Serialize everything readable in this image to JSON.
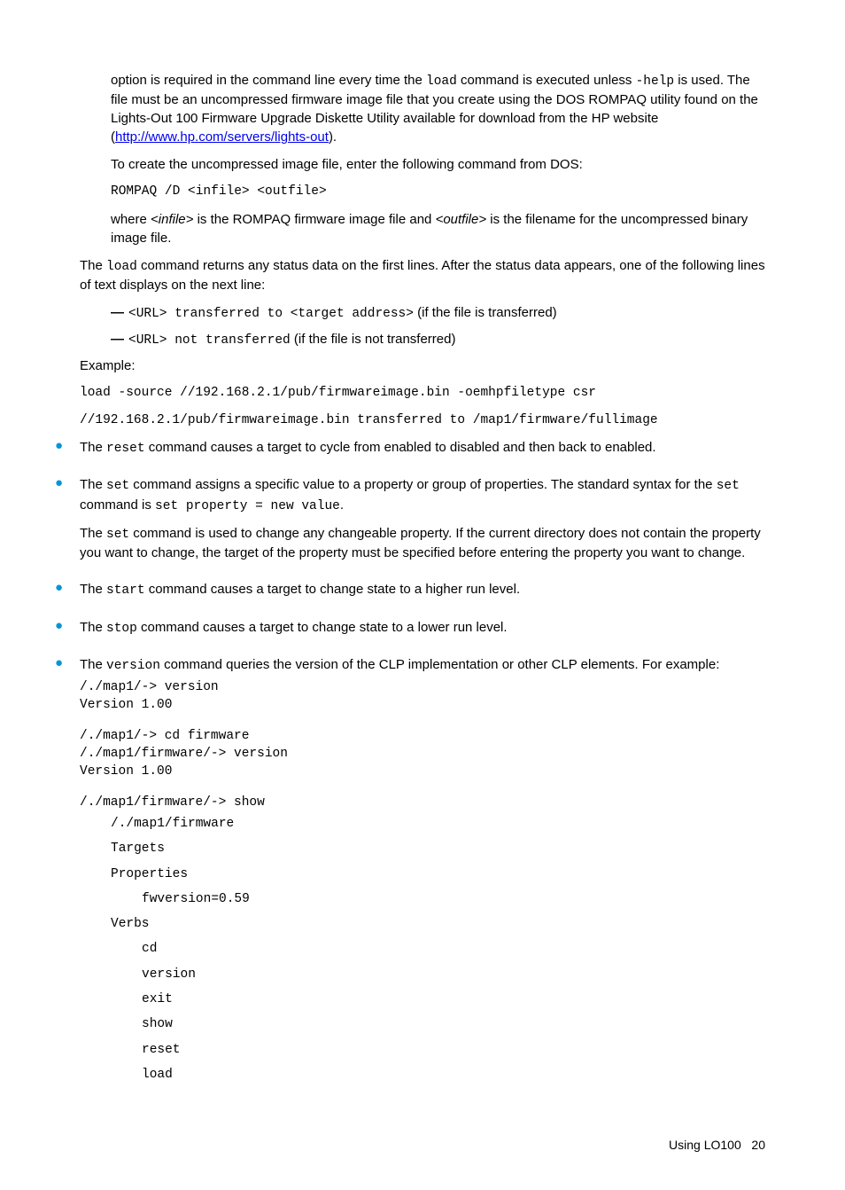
{
  "p1_a": "option is required in the command line every time the ",
  "p1_code1": "load",
  "p1_b": " command is executed unless ",
  "p1_code2": "-help",
  "p1_c": " is used. The file must be an uncompressed firmware image file that you create using the DOS ROMPAQ utility found on the Lights-Out 100 Firmware Upgrade Diskette Utility available for download from the HP website (",
  "p1_link": "http://www.hp.com/servers/lights-out",
  "p1_d": ").",
  "p2": "To create the uncompressed image file, enter the following command from DOS:",
  "p2_code": "ROMPAQ /D <infile> <outfile>",
  "p3_a": "where ",
  "p3_i1": "<infile>",
  "p3_b": " is the ROMPAQ firmware image file and ",
  "p3_i2": "<outfile>",
  "p3_c": " is the filename for the uncompressed binary image file.",
  "p4_a": "The ",
  "p4_code": "load",
  "p4_b": " command returns any status data on the first lines. After the status data appears, one of the following lines of text displays on the next line:",
  "d1_code": "<URL> transferred to <target address>",
  "d1_tail": " (if the file is transferred)",
  "d2_code": "<URL> not transferred",
  "d2_tail": " (if the file is not transferred)",
  "example_label": "Example:",
  "ex1": "load -source //192.168.2.1/pub/firmwareimage.bin -oemhpfiletype csr",
  "ex2": "//192.168.2.1/pub/firmwareimage.bin transferred to /map1/firmware/fullimage",
  "b1_a": "The ",
  "b1_code": "reset",
  "b1_b": " command causes a target to cycle from enabled to disabled and then back to enabled.",
  "b2_a": "The ",
  "b2_code1": "set",
  "b2_b": " command assigns a specific value to a property or group of properties. The standard syntax for the ",
  "b2_code2": "set ",
  "b2_c": " command is ",
  "b2_code3": "set property = new value",
  "b2_d": ".",
  "b2p2_a": "The ",
  "b2p2_code": "set",
  "b2p2_b": " command is used to change any changeable property. If the current directory does not contain the property you want to change, the target of the property must be specified before entering the property you want to change.",
  "b3_a": "The ",
  "b3_code": "start",
  "b3_b": " command causes a target to change state to a higher run level.",
  "b4_a": "The ",
  "b4_code": "stop",
  "b4_b": " command causes a target to change state to a lower run level.",
  "b5_a": "The ",
  "b5_code": "version",
  "b5_b": " command queries the version of the CLP implementation or other CLP elements. For example:",
  "vblock1": "/./map1/-> version\nVersion 1.00",
  "vblock2": "/./map1/-> cd firmware\n/./map1/firmware/-> version\nVersion 1.00",
  "vblock3": "/./map1/firmware/-> show",
  "vline1": "/./map1/firmware",
  "vline2": "Targets",
  "vline3": "Properties",
  "vline3a": "fwversion=0.59",
  "vline4": "Verbs",
  "vline4a": "cd",
  "vline4b": "version",
  "vline4c": "exit",
  "vline4d": "show",
  "vline4e": "reset",
  "vline4f": "load",
  "footer_a": "Using LO100",
  "footer_b": "20"
}
